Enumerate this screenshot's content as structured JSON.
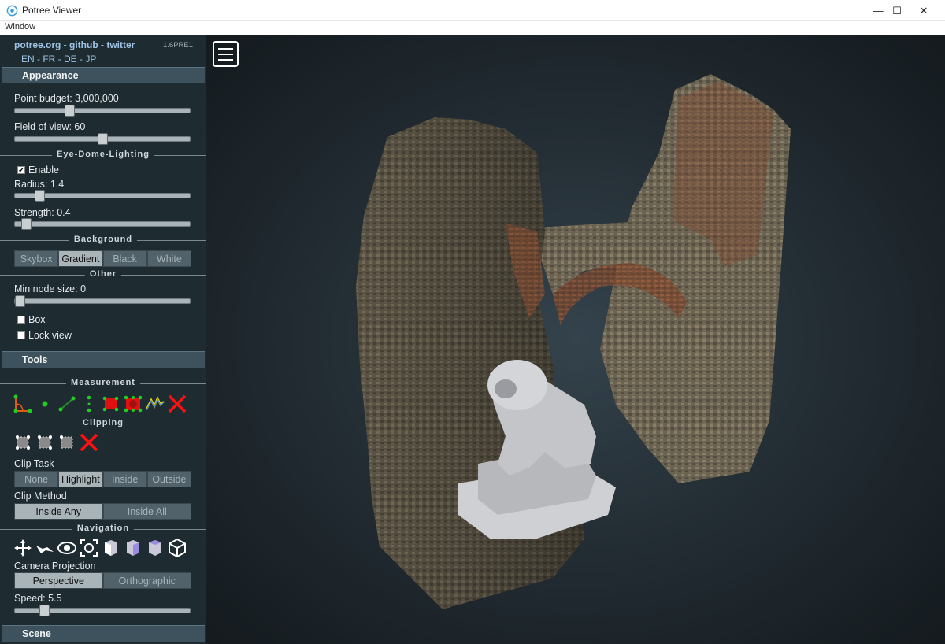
{
  "window": {
    "title": "Potree Viewer",
    "menu": [
      "Window"
    ],
    "controls": {
      "minimize": "—",
      "maximize": "☐",
      "close": "✕"
    }
  },
  "sidebar": {
    "links": "potree.org - github - twitter",
    "version": "1.6PRE1",
    "languages": "EN - FR - DE - JP",
    "appearance": {
      "header": "Appearance",
      "point_budget_label": "Point budget: 3,000,000",
      "point_budget_fraction": 0.3,
      "fov_label": "Field of view: 60",
      "fov_fraction": 0.5,
      "edl_title": "Eye-Dome-Lighting",
      "edl_enable": "Enable",
      "edl_enabled": true,
      "radius_label": "Radius: 1.4",
      "radius_fraction": 0.12,
      "strength_label": "Strength: 0.4",
      "strength_fraction": 0.04,
      "background_title": "Background",
      "background_options": [
        "Skybox",
        "Gradient",
        "Black",
        "White"
      ],
      "background_selected": "Gradient",
      "other_title": "Other",
      "min_node_label": "Min node size: 0",
      "min_node_fraction": 0.0,
      "box_label": "Box",
      "lock_view_label": "Lock view"
    },
    "tools": {
      "header": "Tools",
      "measurement_title": "Measurement",
      "measurement_icons": [
        "angle-icon",
        "point-icon",
        "distance-icon",
        "height-icon",
        "area-icon",
        "volume-icon",
        "profile-icon",
        "remove-measurements-icon"
      ],
      "clipping_title": "Clipping",
      "clipping_icons": [
        "clip-volume-icon",
        "clip-polygon-icon",
        "clip-screen-box-icon",
        "remove-clipping-icon"
      ],
      "clip_task_label": "Clip Task",
      "clip_task_options": [
        "None",
        "Highlight",
        "Inside",
        "Outside"
      ],
      "clip_task_selected": "Highlight",
      "clip_method_label": "Clip Method",
      "clip_method_options": [
        "Inside Any",
        "Inside All"
      ],
      "clip_method_selected": "Inside Any",
      "navigation_title": "Navigation",
      "navigation_icons": [
        "earth-controls-icon",
        "fly-controls-icon",
        "orbit-controls-icon",
        "focus-icon",
        "left-view-icon",
        "front-view-icon",
        "top-view-icon",
        "full-extent-icon"
      ],
      "camera_projection_label": "Camera Projection",
      "projection_options": [
        "Perspective",
        "Orthographic"
      ],
      "projection_selected": "Perspective",
      "speed_label": "Speed: 5.5",
      "speed_fraction": 0.15
    },
    "scene": {
      "header": "Scene"
    }
  },
  "viewport": {
    "menu_icon": "hamburger-menu-icon",
    "background_top": "#34434c",
    "background_edge": "#141a1e"
  }
}
